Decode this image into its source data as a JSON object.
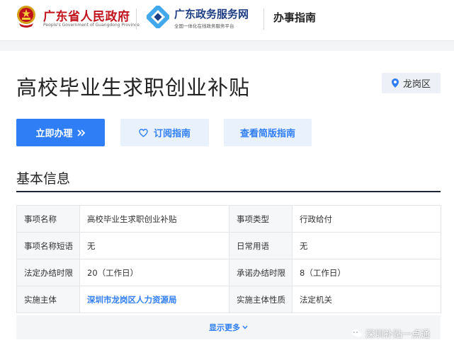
{
  "header": {
    "gov_title": "广东省人民政府",
    "gov_subtitle": "People's Government of Guangdong Province",
    "service_title": "广东政务服务网",
    "service_subtitle": "全国一体化在线政务服务平台",
    "section_title": "办事指南"
  },
  "page": {
    "title": "高校毕业生求职创业补贴",
    "region": "龙岗区"
  },
  "actions": {
    "apply": "立即办理",
    "subscribe": "订阅指南",
    "simple": "查看简版指南"
  },
  "basic_info": {
    "title": "基本信息",
    "rows": [
      {
        "l1": "事项名称",
        "v1": "高校毕业生求职创业补贴",
        "l2": "事项类型",
        "v2": "行政给付"
      },
      {
        "l1": "事项名称短语",
        "v1": "无",
        "l2": "日常用语",
        "v2": "无"
      },
      {
        "l1": "法定办结时限",
        "v1": "20（工作日）",
        "l2": "承诺办结时限",
        "v2": "8（工作日）"
      },
      {
        "l1": "实施主体",
        "v1": "深圳市龙岗区人力资源局",
        "l2": "实施主体性质",
        "v2": "法定机关"
      }
    ],
    "more": "显示更多"
  },
  "watermark": "深圳补贴一点通",
  "colors": {
    "primary": "#2f7ef5",
    "gov_red": "#c0121c",
    "service_blue": "#1f3f85"
  }
}
